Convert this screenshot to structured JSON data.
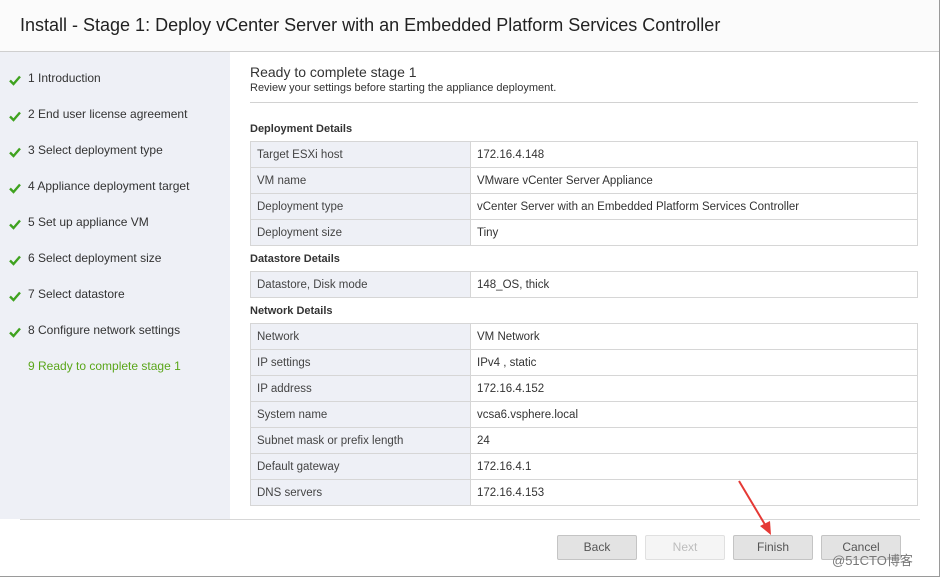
{
  "window": {
    "title": "Install - Stage 1: Deploy vCenter Server with an Embedded Platform Services Controller"
  },
  "sidebar": {
    "steps": [
      {
        "label": "1 Introduction",
        "done": true
      },
      {
        "label": "2 End user license agreement",
        "done": true
      },
      {
        "label": "3 Select deployment type",
        "done": true
      },
      {
        "label": "4 Appliance deployment target",
        "done": true
      },
      {
        "label": "5 Set up appliance VM",
        "done": true
      },
      {
        "label": "6 Select deployment size",
        "done": true
      },
      {
        "label": "7 Select datastore",
        "done": true
      },
      {
        "label": "8 Configure network settings",
        "done": true
      },
      {
        "label": "9 Ready to complete stage 1",
        "done": false,
        "current": true
      }
    ]
  },
  "main": {
    "heading": "Ready to complete stage 1",
    "subheading": "Review your settings before starting the appliance deployment.",
    "sections": {
      "deployment": {
        "title": "Deployment Details",
        "rows": [
          {
            "key": "Target ESXi host",
            "value": "172.16.4.148"
          },
          {
            "key": "VM name",
            "value": "VMware vCenter Server Appliance"
          },
          {
            "key": "Deployment type",
            "value": "vCenter Server with an Embedded Platform Services Controller"
          },
          {
            "key": "Deployment size",
            "value": "Tiny"
          }
        ]
      },
      "datastore": {
        "title": "Datastore Details",
        "rows": [
          {
            "key": "Datastore, Disk mode",
            "value": "148_OS, thick"
          }
        ]
      },
      "network": {
        "title": "Network Details",
        "rows": [
          {
            "key": "Network",
            "value": "VM Network"
          },
          {
            "key": "IP settings",
            "value": "IPv4 , static"
          },
          {
            "key": "IP address",
            "value": "172.16.4.152"
          },
          {
            "key": "System name",
            "value": "vcsa6.vsphere.local"
          },
          {
            "key": "Subnet mask or prefix length",
            "value": "24"
          },
          {
            "key": "Default gateway",
            "value": "172.16.4.1"
          },
          {
            "key": "DNS servers",
            "value": "172.16.4.153"
          }
        ]
      }
    }
  },
  "footer": {
    "back_label": "Back",
    "next_label": "Next",
    "finish_label": "Finish",
    "cancel_label": "Cancel"
  },
  "watermark": "@51CTO博客",
  "colors": {
    "check": "#3fa21f",
    "current_step": "#5aa61a",
    "sidebar_bg": "#eef0f6",
    "arrow": "#e53935"
  }
}
